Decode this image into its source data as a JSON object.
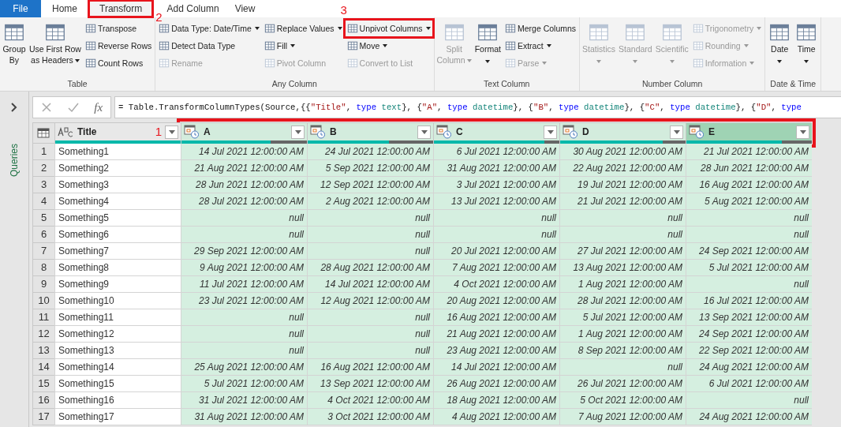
{
  "tabs": [
    {
      "label": "File",
      "kind": "file",
      "selected": false
    },
    {
      "label": "Home",
      "kind": "tab",
      "selected": false
    },
    {
      "label": "Transform",
      "kind": "tab",
      "selected": true,
      "annotation": "2"
    },
    {
      "label": "Add Column",
      "kind": "tab",
      "selected": false
    },
    {
      "label": "View",
      "kind": "tab",
      "selected": false
    }
  ],
  "ribbon": [
    {
      "label": "Table",
      "items": [
        {
          "kind": "large",
          "label": "Group\nBy",
          "dropdown": false,
          "disabled": false
        },
        {
          "kind": "large",
          "label": "Use First Row\nas Headers",
          "dropdown": true,
          "disabled": false
        },
        {
          "kind": "stack",
          "items": [
            {
              "label": "Transpose",
              "dropdown": false,
              "disabled": false
            },
            {
              "label": "Reverse Rows",
              "dropdown": false,
              "disabled": false
            },
            {
              "label": "Count Rows",
              "dropdown": false,
              "disabled": false
            }
          ]
        }
      ]
    },
    {
      "label": "Any Column",
      "items": [
        {
          "kind": "stack",
          "items": [
            {
              "label": "Data Type: Date/Time",
              "dropdown": true,
              "disabled": false
            },
            {
              "label": "Detect Data Type",
              "dropdown": false,
              "disabled": false
            },
            {
              "label": "Rename",
              "dropdown": false,
              "disabled": true
            }
          ]
        },
        {
          "kind": "stack",
          "items": [
            {
              "label": "Replace Values",
              "dropdown": true,
              "disabled": false
            },
            {
              "label": "Fill",
              "dropdown": true,
              "disabled": false
            },
            {
              "label": "Pivot Column",
              "dropdown": false,
              "disabled": true
            }
          ]
        },
        {
          "kind": "stack",
          "items": [
            {
              "label": "Unpivot Columns",
              "dropdown": true,
              "disabled": false,
              "annotation": "3"
            },
            {
              "label": "Move",
              "dropdown": true,
              "disabled": false
            },
            {
              "label": "Convert to List",
              "dropdown": false,
              "disabled": true
            }
          ]
        }
      ]
    },
    {
      "label": "Text Column",
      "items": [
        {
          "kind": "large",
          "label": "Split\nColumn",
          "dropdown": true,
          "disabled": true
        },
        {
          "kind": "large",
          "label": "Format",
          "dropdown": true,
          "disabled": false
        },
        {
          "kind": "stack",
          "items": [
            {
              "label": "Merge Columns",
              "dropdown": false,
              "disabled": false
            },
            {
              "label": "Extract",
              "dropdown": true,
              "disabled": false
            },
            {
              "label": "Parse",
              "dropdown": true,
              "disabled": true
            }
          ]
        }
      ]
    },
    {
      "label": "Number Column",
      "items": [
        {
          "kind": "large",
          "label": "Statistics",
          "dropdown": true,
          "disabled": true
        },
        {
          "kind": "large",
          "label": "Standard",
          "dropdown": true,
          "disabled": true
        },
        {
          "kind": "large",
          "label": "Scientific",
          "dropdown": true,
          "disabled": true
        },
        {
          "kind": "stack",
          "items": [
            {
              "label": "Trigonometry",
              "dropdown": true,
              "disabled": true
            },
            {
              "label": "Rounding",
              "dropdown": true,
              "disabled": true
            },
            {
              "label": "Information",
              "dropdown": true,
              "disabled": true
            }
          ]
        }
      ]
    },
    {
      "label": "Date & Time",
      "items": [
        {
          "kind": "large",
          "label": "Date",
          "dropdown": true,
          "disabled": false
        },
        {
          "kind": "large",
          "label": "Time",
          "dropdown": true,
          "disabled": false
        }
      ]
    }
  ],
  "side_pane": {
    "label": "Queries"
  },
  "formula_bar": {
    "function_label": "fx",
    "tokens": [
      {
        "kind": "plain",
        "text": "= Table.TransformColumnTypes(Source,{{"
      },
      {
        "kind": "string",
        "text": "\"Title\""
      },
      {
        "kind": "plain",
        "text": ", "
      },
      {
        "kind": "keyword",
        "text": "type"
      },
      {
        "kind": "type",
        "text": " text"
      },
      {
        "kind": "plain",
        "text": "}, {"
      },
      {
        "kind": "string",
        "text": "\"A\""
      },
      {
        "kind": "plain",
        "text": ", "
      },
      {
        "kind": "keyword",
        "text": "type"
      },
      {
        "kind": "type",
        "text": " datetime"
      },
      {
        "kind": "plain",
        "text": "}, {"
      },
      {
        "kind": "string",
        "text": "\"B\""
      },
      {
        "kind": "plain",
        "text": ", "
      },
      {
        "kind": "keyword",
        "text": "type"
      },
      {
        "kind": "type",
        "text": " datetime"
      },
      {
        "kind": "plain",
        "text": "}, {"
      },
      {
        "kind": "string",
        "text": "\"C\""
      },
      {
        "kind": "plain",
        "text": ", "
      },
      {
        "kind": "keyword",
        "text": "type"
      },
      {
        "kind": "type",
        "text": " datetime"
      },
      {
        "kind": "plain",
        "text": "}, {"
      },
      {
        "kind": "string",
        "text": "\"D\""
      },
      {
        "kind": "plain",
        "text": ", "
      },
      {
        "kind": "keyword",
        "text": "type"
      }
    ]
  },
  "table": {
    "annotation": "1",
    "columns": [
      {
        "name": "Title",
        "kind": "text",
        "selected": false,
        "focused": false,
        "level": 1
      },
      {
        "name": "A",
        "kind": "datetime",
        "selected": true,
        "focused": false,
        "level": 0.71
      },
      {
        "name": "B",
        "kind": "datetime",
        "selected": true,
        "focused": false,
        "level": 0.65
      },
      {
        "name": "C",
        "kind": "datetime",
        "selected": true,
        "focused": false,
        "level": 0.88
      },
      {
        "name": "D",
        "kind": "datetime",
        "selected": true,
        "focused": false,
        "level": 0.82
      },
      {
        "name": "E",
        "kind": "datetime",
        "selected": true,
        "focused": true,
        "level": 0.76
      }
    ],
    "rows": [
      {
        "number": "1",
        "cells": [
          "Something1",
          "14 Jul 2021 12:00:00 AM",
          "24 Jul 2021 12:00:00 AM",
          "6 Jul 2021 12:00:00 AM",
          "30 Aug 2021 12:00:00 AM",
          "21 Jul 2021 12:00:00 AM"
        ]
      },
      {
        "number": "2",
        "cells": [
          "Something2",
          "21 Aug 2021 12:00:00 AM",
          "5 Sep 2021 12:00:00 AM",
          "31 Aug 2021 12:00:00 AM",
          "22 Aug 2021 12:00:00 AM",
          "28 Jun 2021 12:00:00 AM"
        ]
      },
      {
        "number": "3",
        "cells": [
          "Something3",
          "28 Jun 2021 12:00:00 AM",
          "12 Sep 2021 12:00:00 AM",
          "3 Jul 2021 12:00:00 AM",
          "19 Jul 2021 12:00:00 AM",
          "16 Aug 2021 12:00:00 AM"
        ]
      },
      {
        "number": "4",
        "cells": [
          "Something4",
          "28 Jul 2021 12:00:00 AM",
          "2 Aug 2021 12:00:00 AM",
          "13 Jul 2021 12:00:00 AM",
          "21 Jul 2021 12:00:00 AM",
          "5 Aug 2021 12:00:00 AM"
        ]
      },
      {
        "number": "5",
        "cells": [
          "Something5",
          "null",
          "null",
          "null",
          "null",
          "null"
        ]
      },
      {
        "number": "6",
        "cells": [
          "Something6",
          "null",
          "null",
          "null",
          "null",
          "null"
        ]
      },
      {
        "number": "7",
        "cells": [
          "Something7",
          "29 Sep 2021 12:00:00 AM",
          "null",
          "20 Jul 2021 12:00:00 AM",
          "27 Jul 2021 12:00:00 AM",
          "24 Sep 2021 12:00:00 AM"
        ]
      },
      {
        "number": "8",
        "cells": [
          "Something8",
          "9 Aug 2021 12:00:00 AM",
          "28 Aug 2021 12:00:00 AM",
          "7 Aug 2021 12:00:00 AM",
          "13 Aug 2021 12:00:00 AM",
          "5 Jul 2021 12:00:00 AM"
        ]
      },
      {
        "number": "9",
        "cells": [
          "Something9",
          "11 Jul 2021 12:00:00 AM",
          "14 Jul 2021 12:00:00 AM",
          "4 Oct 2021 12:00:00 AM",
          "1 Aug 2021 12:00:00 AM",
          "null"
        ]
      },
      {
        "number": "10",
        "cells": [
          "Something10",
          "23 Jul 2021 12:00:00 AM",
          "12 Aug 2021 12:00:00 AM",
          "20 Aug 2021 12:00:00 AM",
          "28 Jul 2021 12:00:00 AM",
          "16 Jul 2021 12:00:00 AM"
        ]
      },
      {
        "number": "11",
        "cells": [
          "Something11",
          "null",
          "null",
          "16 Aug 2021 12:00:00 AM",
          "5 Jul 2021 12:00:00 AM",
          "13 Sep 2021 12:00:00 AM"
        ]
      },
      {
        "number": "12",
        "cells": [
          "Something12",
          "null",
          "null",
          "21 Aug 2021 12:00:00 AM",
          "1 Aug 2021 12:00:00 AM",
          "24 Sep 2021 12:00:00 AM"
        ]
      },
      {
        "number": "13",
        "cells": [
          "Something13",
          "null",
          "null",
          "23 Aug 2021 12:00:00 AM",
          "8 Sep 2021 12:00:00 AM",
          "22 Sep 2021 12:00:00 AM"
        ]
      },
      {
        "number": "14",
        "cells": [
          "Something14",
          "25 Aug 2021 12:00:00 AM",
          "16 Aug 2021 12:00:00 AM",
          "14 Jul 2021 12:00:00 AM",
          "null",
          "24 Aug 2021 12:00:00 AM"
        ]
      },
      {
        "number": "15",
        "cells": [
          "Something15",
          "5 Jul 2021 12:00:00 AM",
          "13 Sep 2021 12:00:00 AM",
          "26 Aug 2021 12:00:00 AM",
          "26 Jul 2021 12:00:00 AM",
          "6 Jul 2021 12:00:00 AM"
        ]
      },
      {
        "number": "16",
        "cells": [
          "Something16",
          "31 Jul 2021 12:00:00 AM",
          "4 Oct 2021 12:00:00 AM",
          "18 Aug 2021 12:00:00 AM",
          "5 Oct 2021 12:00:00 AM",
          "null"
        ]
      },
      {
        "number": "17",
        "cells": [
          "Something17",
          "31 Aug 2021 12:00:00 AM",
          "3 Oct 2021 12:00:00 AM",
          "4 Aug 2021 12:00:00 AM",
          "7 Aug 2021 12:00:00 AM",
          "24 Aug 2021 12:00:00 AM"
        ]
      }
    ]
  }
}
